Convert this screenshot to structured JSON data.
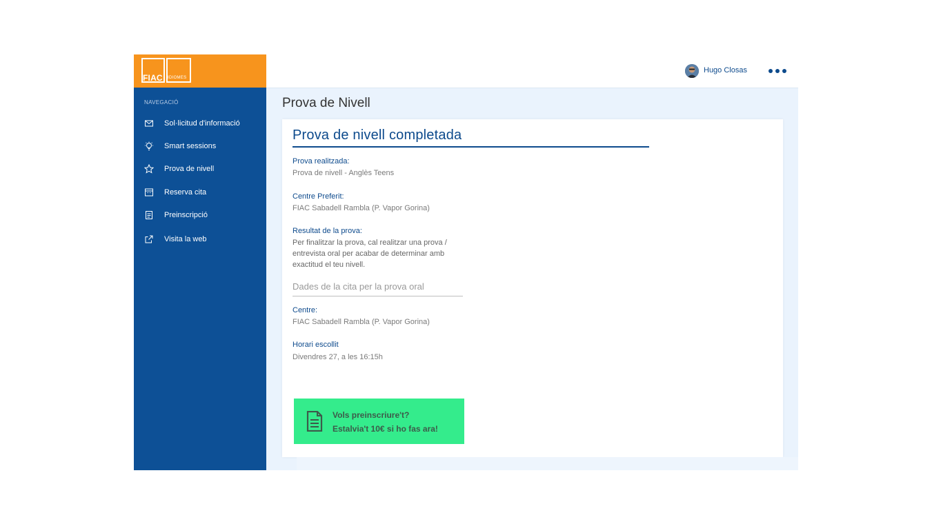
{
  "brand": {
    "logo_text": "FIAC",
    "logo_subtext": "IDIOMES",
    "colors": {
      "orange": "#f7941d",
      "navy": "#0d5096",
      "accent_blue": "#0d4a8c",
      "cta_green": "#34ec8c"
    }
  },
  "sidebar": {
    "heading": "NAVEGACIÓ",
    "items": [
      {
        "label": "Sol·licitud d'informació",
        "icon": "envelope-icon"
      },
      {
        "label": "Smart sessions",
        "icon": "lightbulb-icon"
      },
      {
        "label": "Prova de nivell",
        "icon": "star-icon"
      },
      {
        "label": "Reserva cita",
        "icon": "calendar-icon"
      },
      {
        "label": "Preinscripció",
        "icon": "document-icon"
      },
      {
        "label": "Visita la web",
        "icon": "external-link-icon"
      }
    ]
  },
  "header": {
    "user_name": "Hugo Closas",
    "menu_icon": "more-dots-icon"
  },
  "main": {
    "page_title": "Prova de Nivell",
    "card": {
      "title": "Prova de nivell completada",
      "test_label": "Prova realitzada:",
      "test_value": "Prova de nivell - Anglès Teens",
      "center_pref_label": "Centre Preferit:",
      "center_pref_value": "FIAC Sabadell Rambla (P. Vapor Gorina)",
      "result_label": "Resultat de la prova:",
      "result_value": "Per finalitzar la prova, cal realitzar una prova / entrevista oral per acabar de determinar amb exactitud el teu nivell.",
      "oral_section_title": "Dades de la cita per la prova oral",
      "center_label": "Centre:",
      "center_value": "FIAC Sabadell Rambla (P. Vapor Gorina)",
      "schedule_label": "Horari escollit",
      "schedule_value": "Divendres 27, a les 16:15h",
      "cta": {
        "line1": "Vols preinscriure't?",
        "line2": "Estalvia't 10€ si ho fas ara!",
        "icon": "document-icon"
      }
    }
  }
}
